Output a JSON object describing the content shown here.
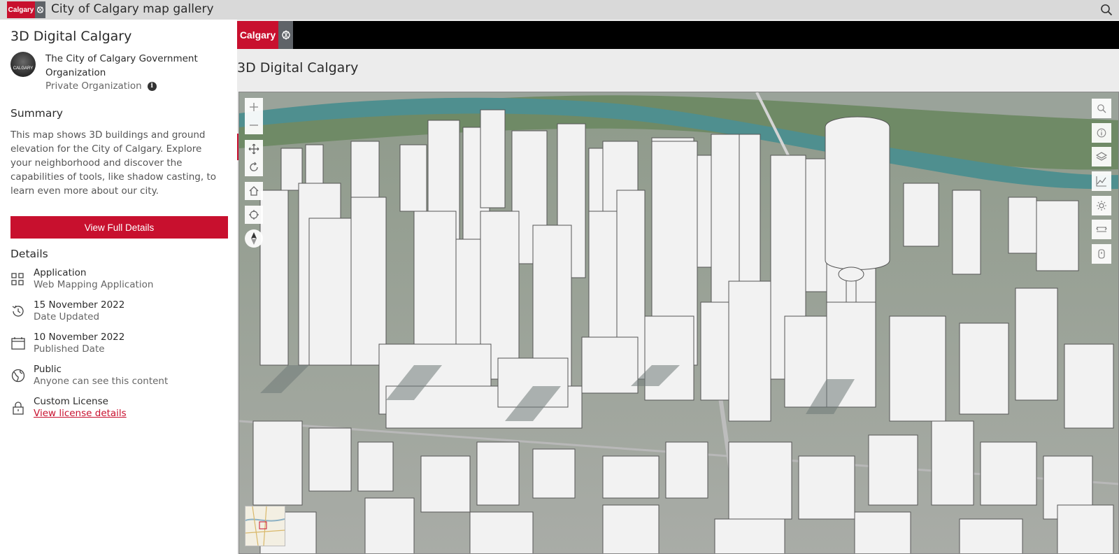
{
  "topbar": {
    "logo_text": "Calgary",
    "title": "City of Calgary map gallery",
    "search_icon": "search-icon"
  },
  "sidebar": {
    "title": "3D Digital Calgary",
    "owner": {
      "avatar_text": "CALGARY",
      "name": "The City of Calgary Government Organization",
      "type": "Private Organization",
      "info_icon": "info-icon"
    },
    "summary": {
      "heading": "Summary",
      "text": "This map shows 3D buildings and ground elevation for the City of Calgary. Explore your neighborhood and discover the capabilities of tools, like shadow casting, to learn even more about our city."
    },
    "view_button": "View Full Details",
    "details": {
      "heading": "Details",
      "items": [
        {
          "icon": "grid-icon",
          "label": "Application",
          "sub": "Web Mapping Application"
        },
        {
          "icon": "history-icon",
          "label": "15 November 2022",
          "sub": "Date Updated"
        },
        {
          "icon": "calendar-icon",
          "label": "10 November 2022",
          "sub": "Published Date"
        },
        {
          "icon": "globe-icon",
          "label": "Public",
          "sub": "Anyone can see this content"
        },
        {
          "icon": "lock-icon",
          "label": "Custom License",
          "link": "View license details"
        }
      ]
    }
  },
  "main": {
    "logo_text": "Calgary",
    "title": "3D Digital Calgary"
  },
  "scene": {
    "left_tools": [
      "zoom-in-icon",
      "zoom-out-icon",
      "pan-icon",
      "rotate-icon",
      "home-icon",
      "locate-icon",
      "compass-icon"
    ],
    "right_tools": [
      "search-icon",
      "info-icon",
      "layers-icon",
      "elevation-profile-icon",
      "daylight-icon",
      "measure-icon",
      "slice-icon"
    ]
  },
  "colors": {
    "brand_red": "#c8102e",
    "topbar_gray": "#d9d9d9",
    "river": "#4f8f8f"
  }
}
